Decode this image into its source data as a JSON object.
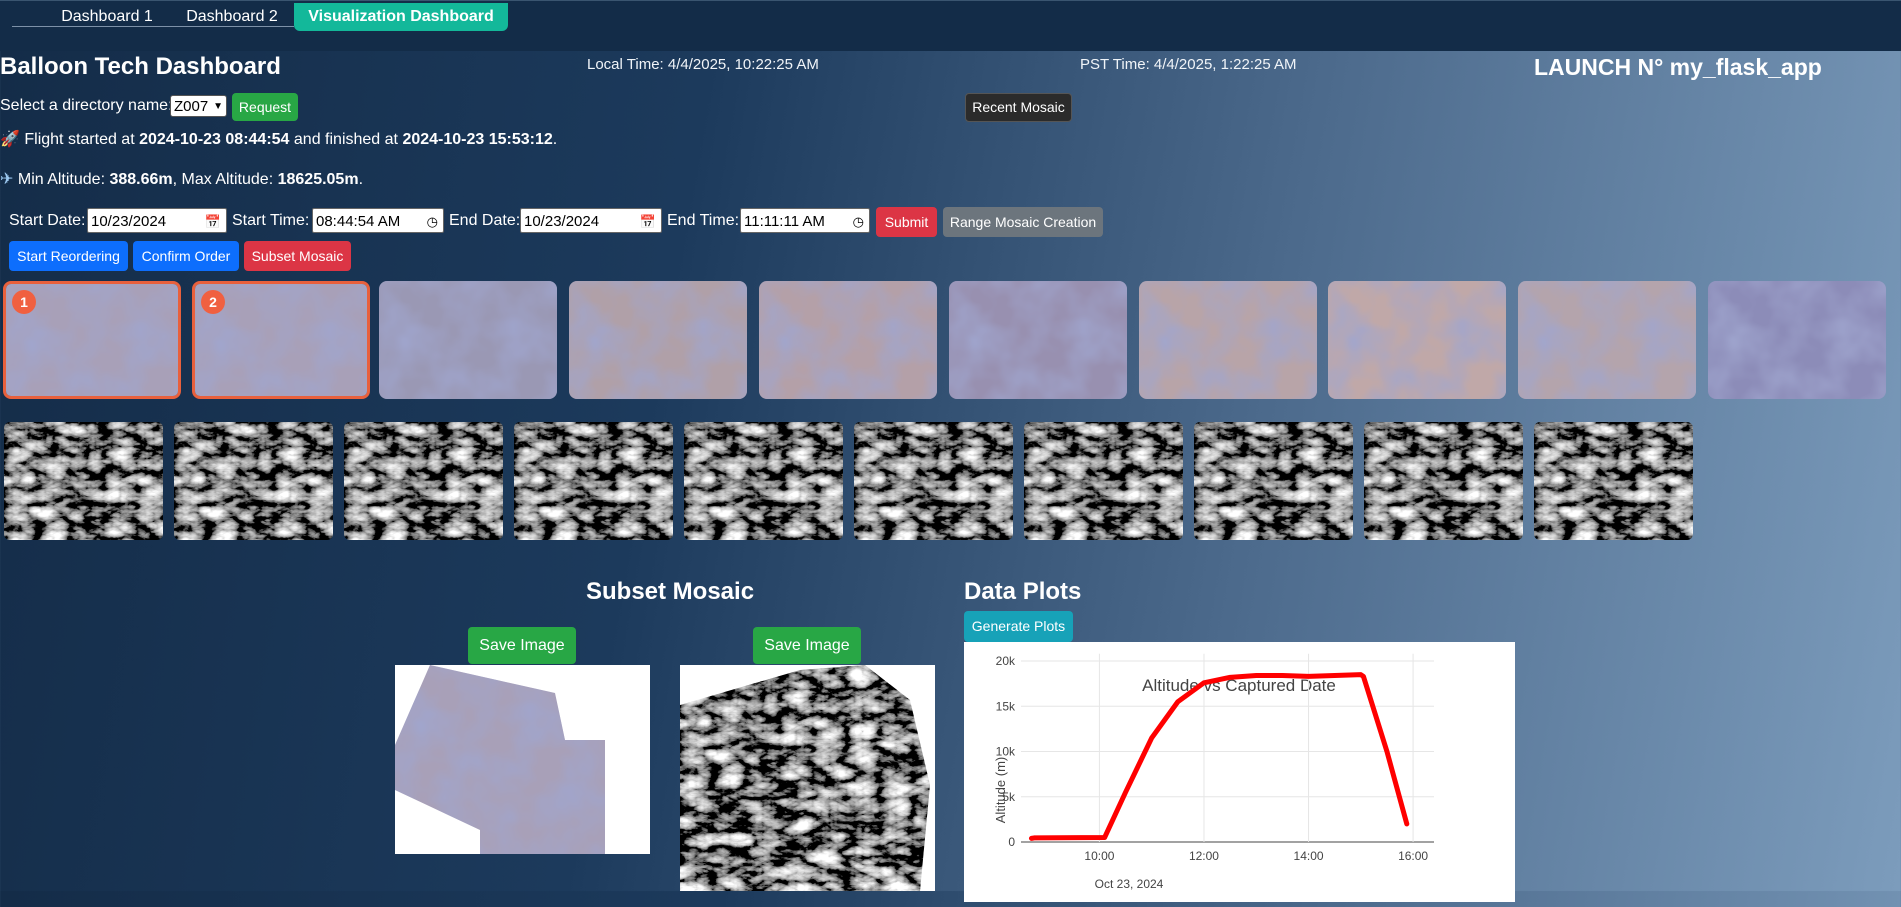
{
  "nav": {
    "tabs": [
      {
        "label": "Dashboard 1"
      },
      {
        "label": "Dashboard 2"
      },
      {
        "label": "Visualization Dashboard"
      }
    ]
  },
  "header": {
    "title": "Balloon Tech Dashboard",
    "local_time": "Local Time: 4/4/2025, 10:22:25 AM",
    "pst_time": "PST Time: 4/4/2025, 1:22:25 AM",
    "launch": "LAUNCH N° my_flask_app"
  },
  "directory": {
    "label": "Select a directory name:",
    "selected": "Z007",
    "request_label": "Request",
    "recent_mosaic_label": "Recent Mosaic"
  },
  "flight": {
    "prefix": "Flight started at",
    "start": "2024-10-23 08:44:54",
    "middle": "and finished at",
    "end": "2024-10-23 15:53:12",
    "suffix": ".",
    "min_prefix": "Min Altitude:",
    "min_altitude": "388.66m",
    "max_prefix": ", Max Altitude:",
    "max_altitude": "18625.05m",
    "alt_suffix": "."
  },
  "filters": {
    "start_date_label": "Start Date:",
    "start_date": "10/23/2024",
    "start_time_label": "Start Time:",
    "start_time": "08:44:54 AM",
    "end_date_label": "End Date:",
    "end_date": "10/23/2024",
    "end_time_label": "End Time:",
    "end_time": "11:11:11 AM",
    "submit_label": "Submit",
    "range_label": "Range Mosaic Creation"
  },
  "actions": {
    "start_reordering": "Start Reordering",
    "confirm_order": "Confirm Order",
    "subset_mosaic": "Subset Mosaic"
  },
  "thumbnails": {
    "badges": [
      "1",
      "2"
    ]
  },
  "subset": {
    "title": "Subset Mosaic",
    "save_label_1": "Save Image",
    "save_label_2": "Save Image"
  },
  "plots": {
    "title": "Data Plots",
    "generate_label": "Generate Plots"
  },
  "chart_data": {
    "type": "line",
    "title": "Altitude vs Captured Date",
    "ylabel": "Altitude (m)",
    "xlabel": "",
    "x_ticks": [
      "10:00",
      "12:00",
      "14:00",
      "16:00"
    ],
    "x_sublabel": "Oct 23, 2024",
    "y_ticks": [
      "0",
      "5k",
      "10k",
      "15k",
      "20k"
    ],
    "ylim": [
      0,
      21000
    ],
    "xlim_hours": [
      8.5,
      16.4
    ],
    "series": [
      {
        "color": "#0000ff",
        "x": [
          8.75,
          9.0,
          9.5,
          10.0,
          10.1
        ],
        "y": [
          400,
          450,
          480,
          500,
          500
        ]
      },
      {
        "color": "#ff0000",
        "x": [
          8.7,
          8.75,
          10.1,
          10.5,
          11.0,
          11.5,
          12.0,
          12.5,
          13.0,
          13.5,
          14.0,
          14.5,
          15.0,
          15.05,
          15.5,
          15.88
        ],
        "y": [
          400,
          450,
          500,
          5500,
          11500,
          15500,
          17600,
          18200,
          18400,
          18400,
          18300,
          18400,
          18500,
          18300,
          10000,
          2000
        ]
      }
    ]
  }
}
